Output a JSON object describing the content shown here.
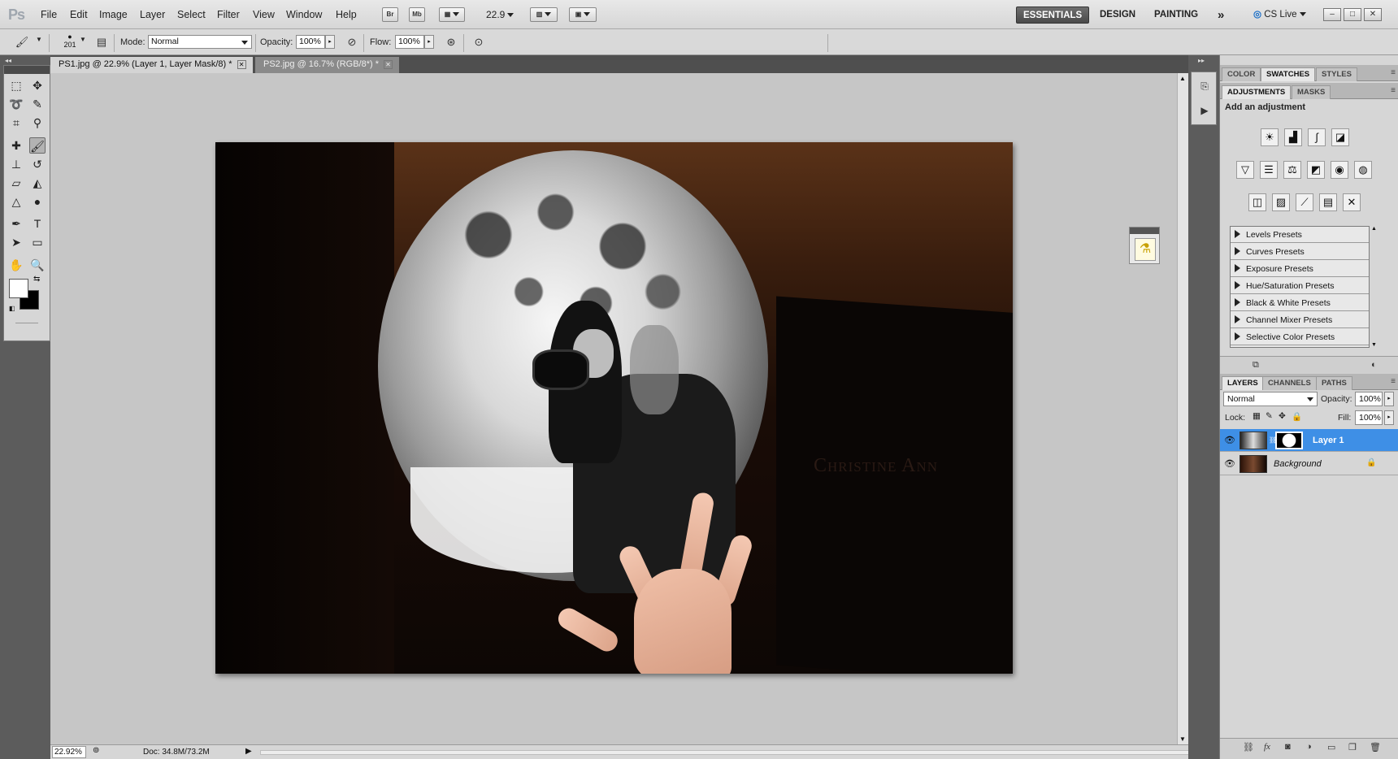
{
  "app": {
    "logo": "Ps",
    "menus": [
      "File",
      "Edit",
      "Image",
      "Layer",
      "Select",
      "Filter",
      "View",
      "Window",
      "Help"
    ],
    "bridge_btn": "Br",
    "minibridge_btn": "Mb",
    "zoom_value": "22.9",
    "workspaces": [
      "ESSENTIALS",
      "DESIGN",
      "PAINTING"
    ],
    "more_workspaces": "»",
    "cslive": "CS Live"
  },
  "options": {
    "brush_size": "201",
    "mode_label": "Mode:",
    "mode_value": "Normal",
    "opacity_label": "Opacity:",
    "opacity_value": "100%",
    "flow_label": "Flow:",
    "flow_value": "100%"
  },
  "document_tabs": [
    {
      "title": "PS1.jpg @ 22.9% (Layer 1, Layer Mask/8) *",
      "active": true
    },
    {
      "title": "PS2.jpg @ 16.7% (RGB/8*) *",
      "active": false
    }
  ],
  "canvas": {
    "watermark": "Christine Ann"
  },
  "status": {
    "zoom": "22.92%",
    "doc_size": "Doc: 34.8M/73.2M"
  },
  "panel_top_tabs": [
    "COLOR",
    "SWATCHES",
    "STYLES"
  ],
  "adjustments": {
    "tabs": [
      "ADJUSTMENTS",
      "MASKS"
    ],
    "title": "Add an adjustment",
    "icons_row1": [
      "brightness-contrast-icon",
      "levels-icon",
      "curves-icon",
      "exposure-icon"
    ],
    "icons_row2": [
      "vibrance-icon",
      "hue-saturation-icon",
      "color-balance-icon",
      "black-white-icon",
      "photo-filter-icon",
      "channel-mixer-icon"
    ],
    "icons_row3": [
      "invert-icon",
      "posterize-icon",
      "threshold-icon",
      "gradient-map-icon",
      "selective-color-icon"
    ],
    "presets": [
      "Levels Presets",
      "Curves Presets",
      "Exposure Presets",
      "Hue/Saturation Presets",
      "Black & White Presets",
      "Channel Mixer Presets",
      "Selective Color Presets"
    ]
  },
  "layers_panel": {
    "tabs": [
      "LAYERS",
      "CHANNELS",
      "PATHS"
    ],
    "blend_mode": "Normal",
    "opacity_label": "Opacity:",
    "opacity_value": "100%",
    "lock_label": "Lock:",
    "fill_label": "Fill:",
    "fill_value": "100%",
    "layers": [
      {
        "name": "Layer 1",
        "selected": true,
        "has_mask": true
      },
      {
        "name": "Background",
        "selected": false,
        "locked": true
      }
    ]
  },
  "colors": {
    "selection_blue": "#3e8fe6",
    "workspace_active": "#4a4a4a"
  }
}
